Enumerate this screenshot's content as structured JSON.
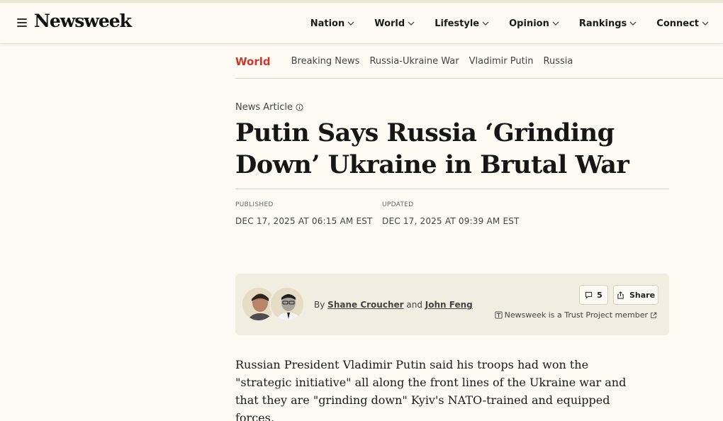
{
  "header": {
    "logo": "Newsweek",
    "nav": [
      {
        "label": "Nation"
      },
      {
        "label": "World"
      },
      {
        "label": "Lifestyle"
      },
      {
        "label": "Opinion"
      },
      {
        "label": "Rankings"
      },
      {
        "label": "Connect"
      }
    ]
  },
  "subnav": {
    "section": "World",
    "topics": [
      "Breaking News",
      "Russia-Ukraine War",
      "Vladimir Putin",
      "Russia"
    ]
  },
  "article": {
    "type": "News Article",
    "headline": "Putin Says Russia ‘Grinding Down’ Ukraine in Brutal War",
    "published_label": "PUBLISHED",
    "published_value": "DEC 17, 2025 AT 06:15 AM EST",
    "updated_label": "UPDATED",
    "updated_value": "DEC 17, 2025 AT 09:39 AM EST",
    "byline_prefix": "By",
    "author1": "Shane Croucher",
    "byline_and": "and",
    "author2": "John Feng",
    "comments_count": "5",
    "share_label": "Share",
    "trust_text": "Newsweek is a Trust Project member",
    "body": "Russian President Vladimir Putin said his troops had won the \"strategic initiative\" all along the front lines of the Ukraine war and that they are \"grinding down\" Kyiv's NATO-trained and equipped forces."
  },
  "colors": {
    "accent": "#c8392b",
    "background": "#fdfaf3",
    "byline_box": "#f2ede1"
  }
}
